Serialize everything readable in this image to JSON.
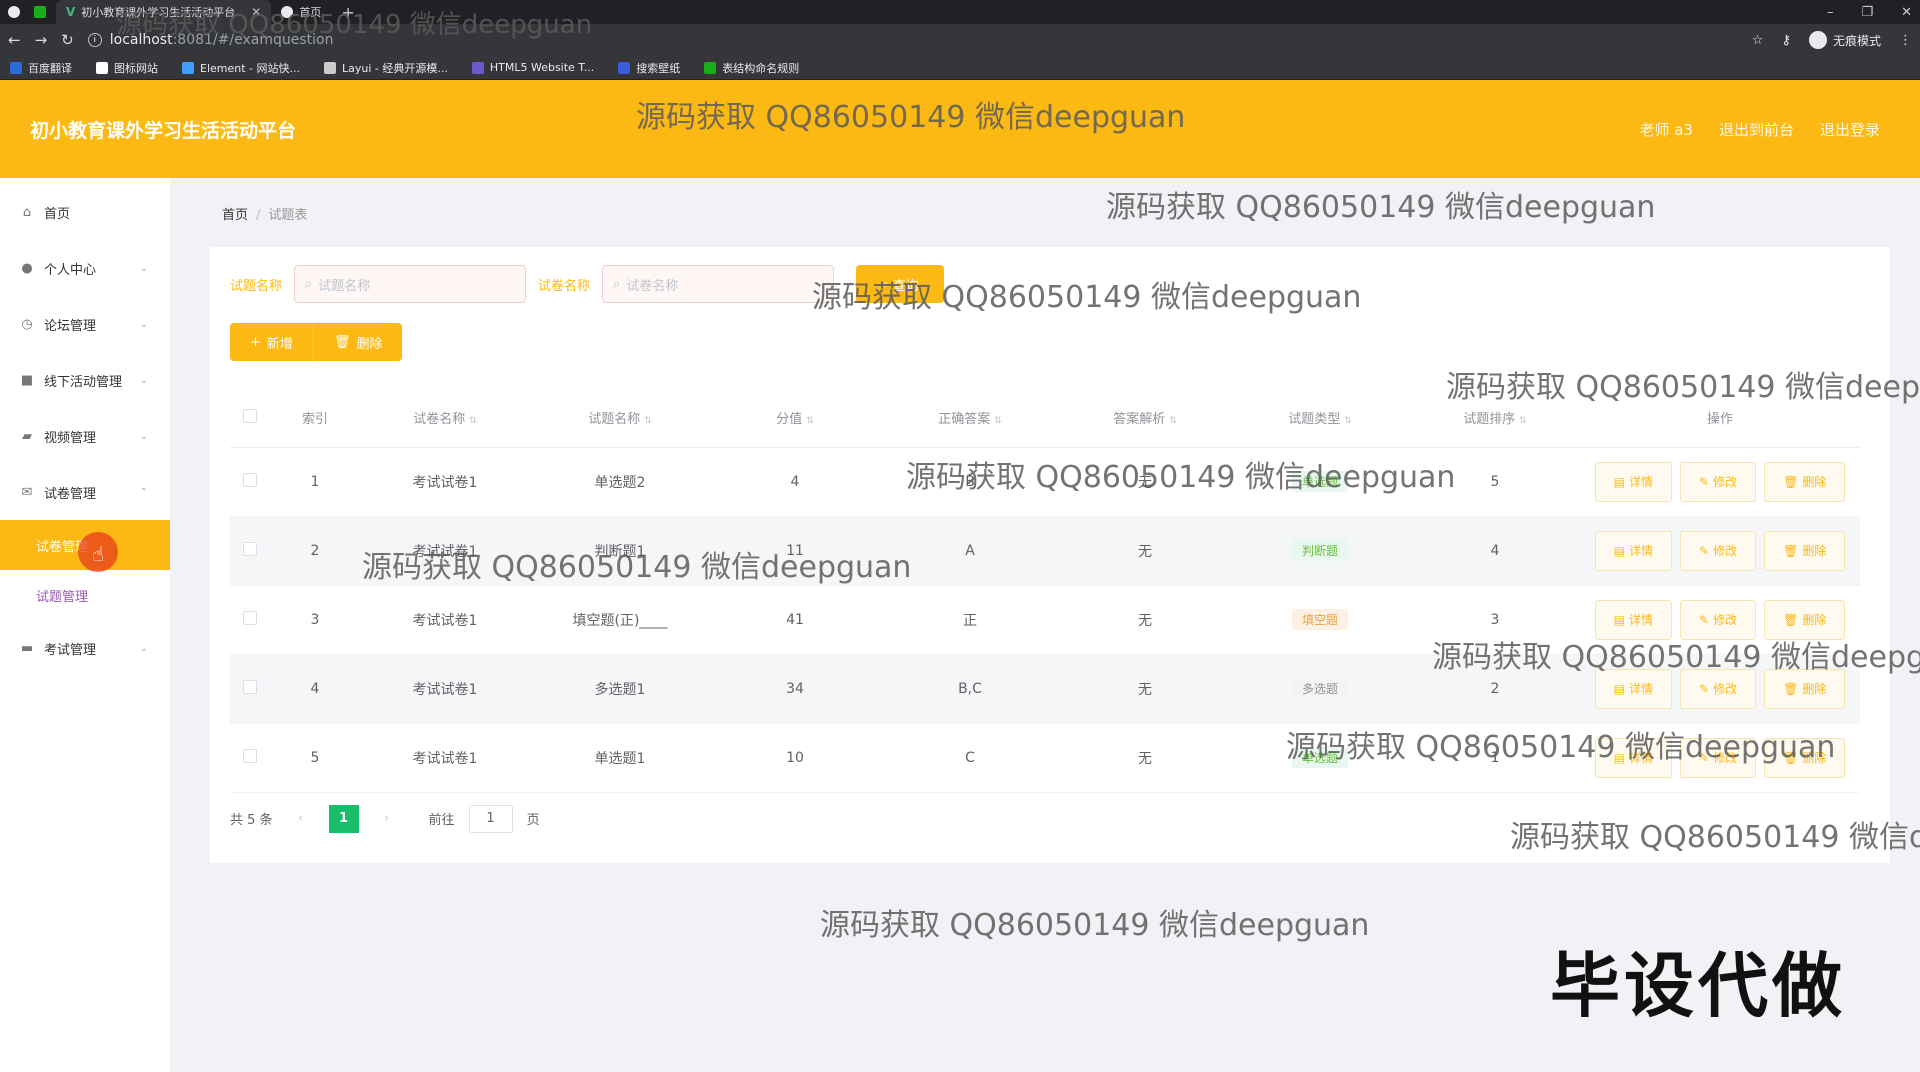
{
  "browser": {
    "tabs": [
      {
        "title": "初小教育课外学习生活活动平台",
        "active": true
      },
      {
        "title": "首页",
        "active": false
      }
    ],
    "url_host": "localhost",
    "url_path": ":8081/#/examquestion",
    "incognito_label": "无痕模式",
    "bookmarks": [
      {
        "label": "百度翻译",
        "color": "#2f6bd8"
      },
      {
        "label": "图标网站",
        "color": "#ffffff"
      },
      {
        "label": "Element - 网站快...",
        "color": "#409eff"
      },
      {
        "label": "Layui - 经典开源模...",
        "color": "#cccccc"
      },
      {
        "label": "HTML5 Website T...",
        "color": "#6a5acd"
      },
      {
        "label": "搜索壁纸",
        "color": "#3b5bdb"
      },
      {
        "label": "表结构命名规则",
        "color": "#1aad19"
      }
    ]
  },
  "header": {
    "title": "初小教育课外学习生活活动平台",
    "user": "老师 a3",
    "to_front": "退出到前台",
    "logout": "退出登录"
  },
  "sidebar": {
    "items": [
      {
        "label": "首页",
        "icon": "home-icon",
        "glyph": "⌂",
        "chevron": ""
      },
      {
        "label": "个人中心",
        "icon": "user-icon",
        "glyph": "●",
        "chevron": "⌄"
      },
      {
        "label": "论坛管理",
        "icon": "clock-icon",
        "glyph": "◷",
        "chevron": "⌄"
      },
      {
        "label": "线下活动管理",
        "icon": "folder-icon",
        "glyph": "■",
        "chevron": "⌄"
      },
      {
        "label": "视频管理",
        "icon": "video-icon",
        "glyph": "▰",
        "chevron": "⌄"
      },
      {
        "label": "试卷管理",
        "icon": "mail-icon",
        "glyph": "✉",
        "chevron": "⌃"
      },
      {
        "label": "考试管理",
        "icon": "exam-icon",
        "glyph": "▬",
        "chevron": "⌄"
      }
    ],
    "sub_items": [
      {
        "label": "试卷管理",
        "active": true
      },
      {
        "label": "试题管理",
        "active": false
      }
    ]
  },
  "breadcrumb": {
    "home": "首页",
    "current": "试题表"
  },
  "search": {
    "label1": "试题名称",
    "placeholder1": "试题名称",
    "label2": "试卷名称",
    "placeholder2": "试卷名称",
    "button": "查询"
  },
  "actions": {
    "add": "新增",
    "delete": "删除"
  },
  "table": {
    "columns": [
      "索引",
      "试卷名称",
      "试题名称",
      "分值",
      "正确答案",
      "答案解析",
      "试题类型",
      "试题排序",
      "操作"
    ],
    "rows": [
      {
        "index": "1",
        "paper": "考试试卷1",
        "question": "单选题2",
        "score": "4",
        "answer": "B",
        "analysis": "无",
        "type": "单选题",
        "type_color": "green",
        "order": "5"
      },
      {
        "index": "2",
        "paper": "考试试卷1",
        "question": "判断题1",
        "score": "11",
        "answer": "A",
        "analysis": "无",
        "type": "判断题",
        "type_color": "green",
        "order": "4"
      },
      {
        "index": "3",
        "paper": "考试试卷1",
        "question": "填空题(正)____",
        "score": "41",
        "answer": "正",
        "analysis": "无",
        "type": "填空题",
        "type_color": "orange",
        "order": "3"
      },
      {
        "index": "4",
        "paper": "考试试卷1",
        "question": "多选题1",
        "score": "34",
        "answer": "B,C",
        "analysis": "无",
        "type": "多选题",
        "type_color": "gray",
        "order": "2"
      },
      {
        "index": "5",
        "paper": "考试试卷1",
        "question": "单选题1",
        "score": "10",
        "answer": "C",
        "analysis": "无",
        "type": "单选题",
        "type_color": "green",
        "order": "1"
      }
    ],
    "op_detail": "详情",
    "op_edit": "修改",
    "op_delete": "删除"
  },
  "pagination": {
    "total": "共 5 条",
    "current": "1",
    "goto": "前往",
    "goto_value": "1",
    "page_unit": "页"
  },
  "watermark": {
    "text": "源码获取 QQ86050149 微信deepguan",
    "stamp": "毕设代做"
  }
}
